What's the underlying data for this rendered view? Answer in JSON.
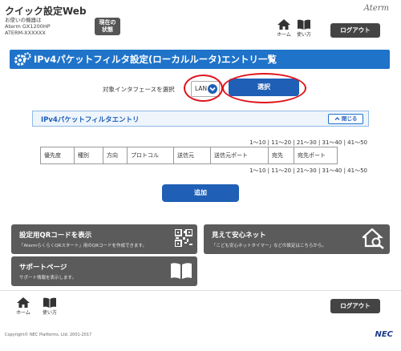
{
  "header": {
    "app_title": "クイック設定Web",
    "device_lines": [
      "お使いの機器は",
      "Aterm GX1200HP",
      "ATERM-XXXXXX"
    ],
    "status_button": [
      "現在の",
      "状態"
    ],
    "brand": "Aterm",
    "home_label": "ホーム",
    "help_label": "使い方",
    "logout_label": "ログアウト"
  },
  "page": {
    "title": "IPv4パケットフィルタ設定(ローカルルータ)エントリ一覧",
    "interface_label": "対象インタフェースを選択",
    "interface_value": "LAN",
    "select_button": "選択"
  },
  "panel": {
    "title": "IPv4パケットフィルタエントリ",
    "close_button": "閉じる"
  },
  "pager": [
    "1～10",
    "11～20",
    "21～30",
    "31～40",
    "41～50"
  ],
  "table": {
    "columns": [
      "優先度",
      "種別",
      "方向",
      "プロトコル",
      "送信元",
      "送信元ポート",
      "宛先",
      "宛先ポート"
    ]
  },
  "add_button": "追加",
  "cards": {
    "qr": {
      "title": "設定用QRコードを表示",
      "desc": "「AtermらくらくQRスタート」用のQRコードを作成できます。"
    },
    "safe": {
      "title": "見えて安心ネット",
      "desc": "「こども安心ネットタイマー」などの設定はこちらから。"
    },
    "support": {
      "title": "サポートページ",
      "desc": "サポート情報を表示します。"
    }
  },
  "footer": {
    "home_label": "ホーム",
    "help_label": "使い方",
    "logout_label": "ログアウト",
    "copyright": "Copyright© NEC Platforms, Ltd. 2001-2017",
    "nec": "NEC"
  },
  "colors": {
    "accent": "#1f73c9",
    "button": "#1f5fb6",
    "highlight_ring": "#e0141b",
    "card": "#5b5b5b"
  }
}
